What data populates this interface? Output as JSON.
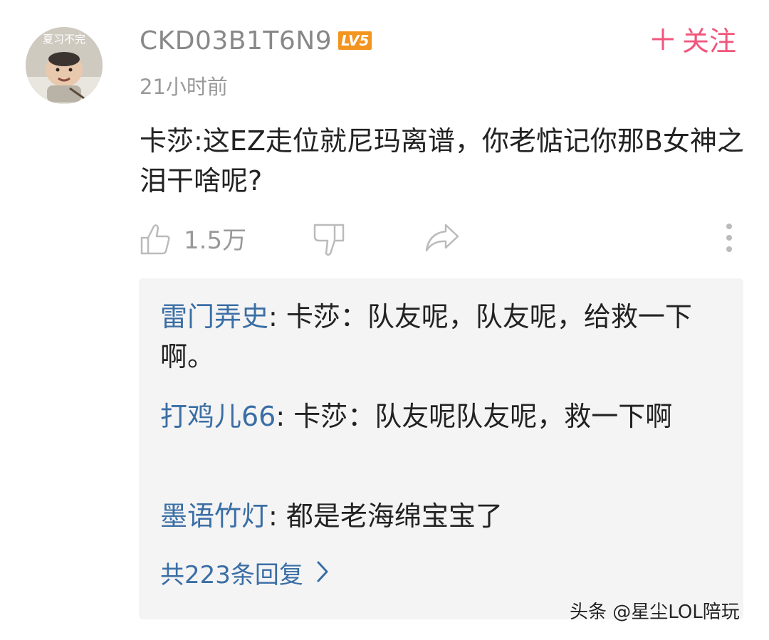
{
  "header": {
    "avatar_caption": "夏习不完",
    "username": "CKD03B1T6N9",
    "level": "LV5",
    "follow_label": "关注",
    "timestamp": "21小时前"
  },
  "comment": {
    "text": "卡莎:这EZ走位就尼玛离谱，你老惦记你那B女神之泪干啥呢?"
  },
  "actions": {
    "like_count": "1.5万",
    "icons": [
      "thumbs-up-icon",
      "thumbs-down-icon",
      "share-icon",
      "more-vertical-icon"
    ]
  },
  "replies": {
    "items": [
      {
        "author": "雷门弄史",
        "sep": ": ",
        "text": "卡莎：队友呢，队友呢，给救一下啊。"
      },
      {
        "author": "打鸡儿66",
        "sep": ": ",
        "text": "卡莎：队友呢队友呢，救一下啊"
      },
      {
        "author": "墨语竹灯",
        "sep": ": ",
        "text": "都是老海绵宝宝了"
      }
    ],
    "total_label": "共223条回复"
  },
  "watermark": "头条 @星尘LOL陪玩",
  "colors": {
    "follow": "#f0567c",
    "link": "#3a6ea5",
    "level_badge": "#f3941f",
    "muted": "#999999",
    "reply_bg": "#f4f4f4"
  }
}
